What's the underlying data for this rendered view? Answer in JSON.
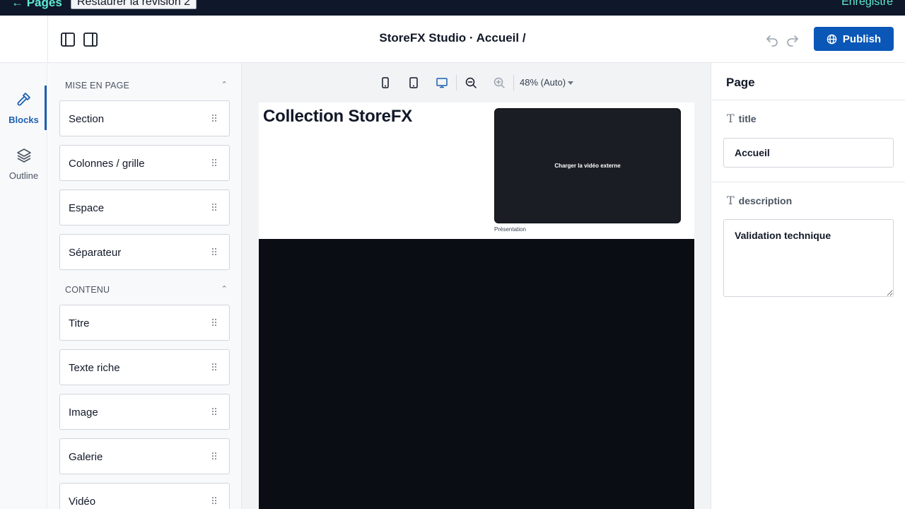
{
  "topbar": {
    "back_link": "← Pages",
    "restore_button": "Restaurer la révision 2",
    "save_status": "Enregistré"
  },
  "header": {
    "title": "StoreFX Studio · Accueil /",
    "publish_label": "Publish",
    "accent_color": "#0b57b8"
  },
  "rail": {
    "items": [
      {
        "label": "Blocks",
        "icon": "hammer-icon",
        "active": true
      },
      {
        "label": "Outline",
        "icon": "layers-icon",
        "active": false
      }
    ]
  },
  "blocks_panel": {
    "sections": [
      {
        "title": "MISE EN PAGE",
        "items": [
          "Section",
          "Colonnes / grille",
          "Espace",
          "Séparateur"
        ]
      },
      {
        "title": "CONTENU",
        "items": [
          "Titre",
          "Texte riche",
          "Image",
          "Galerie",
          "Vidéo"
        ]
      }
    ]
  },
  "canvas": {
    "zoom_label": "48% (Auto)",
    "active_device": "desktop",
    "page": {
      "hero_title": "Collection StoreFX",
      "video_label": "Charger la vidéo externe",
      "video_caption": "Présentation"
    }
  },
  "properties": {
    "panel_title": "Page",
    "fields": {
      "title_label": "title",
      "title_value": "Accueil",
      "description_label": "description",
      "description_value": "Validation technique"
    }
  }
}
